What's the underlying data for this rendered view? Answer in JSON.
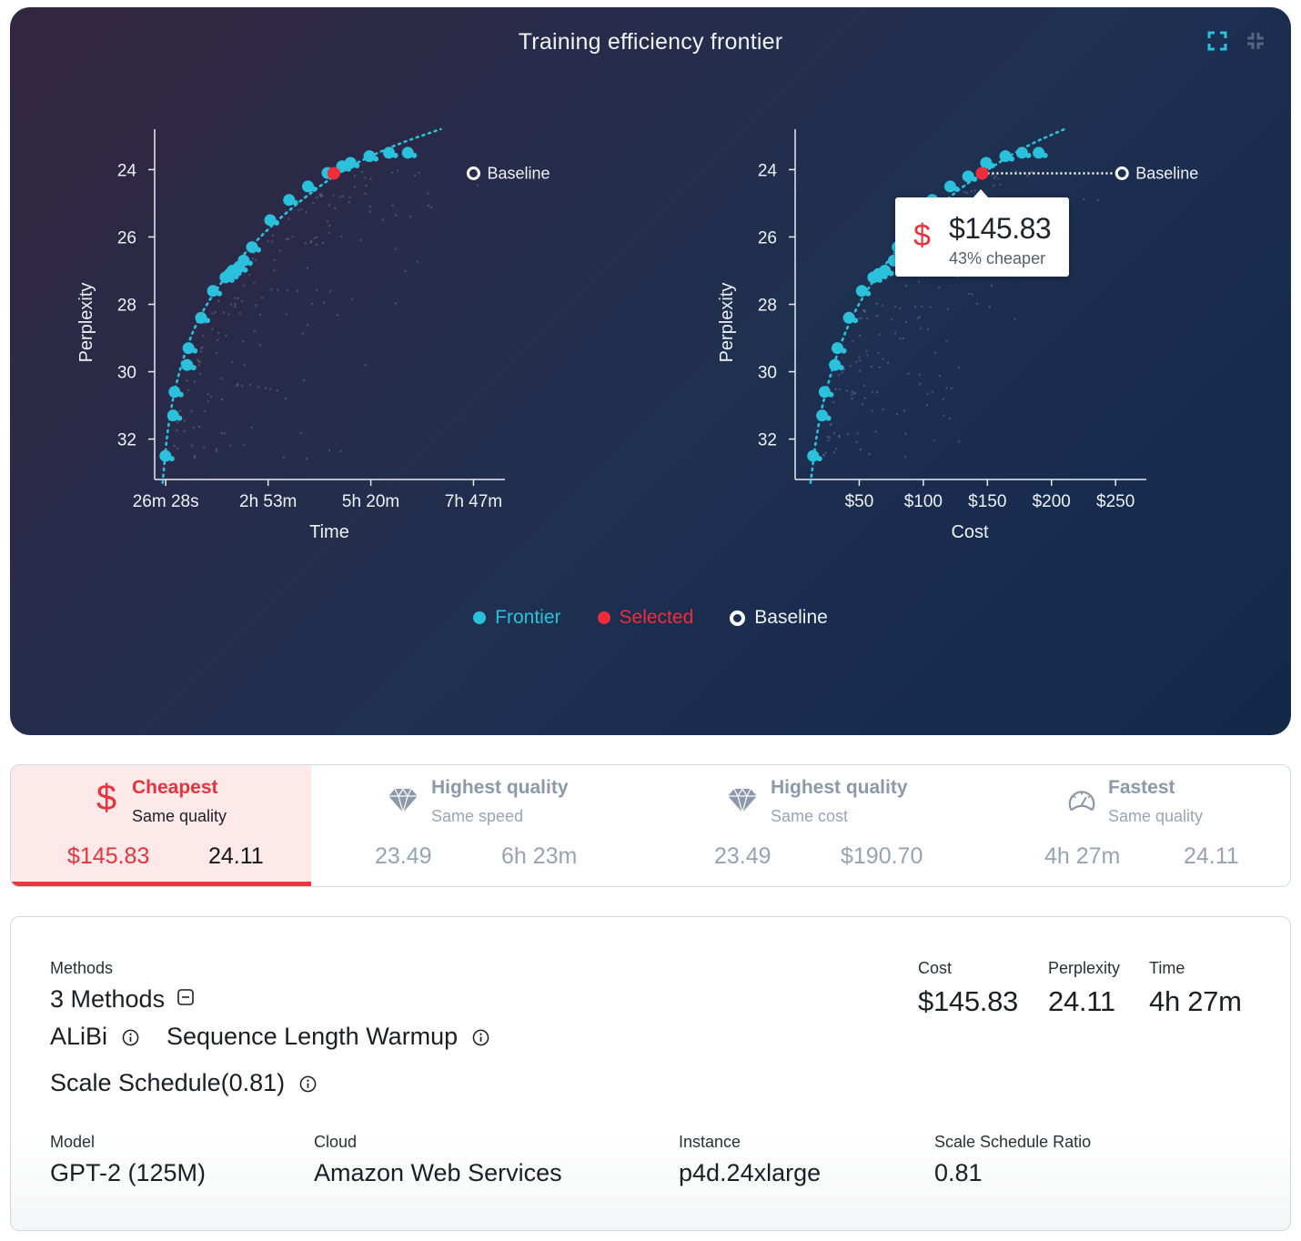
{
  "header": {
    "title": "Training efficiency frontier",
    "expand_icon": "expand-icon",
    "collapse_icon": "collapse-icon"
  },
  "colors": {
    "frontier": "#2bc1dc",
    "selected": "#ee2c3a",
    "baseline": "#ffffff",
    "accent_red": "#e8333d",
    "muted": "#8d99aa"
  },
  "tooltip": {
    "icon": "dollar-icon",
    "value": "$145.83",
    "subtitle": "43% cheaper"
  },
  "legend": [
    {
      "label": "Frontier",
      "kind": "frontier"
    },
    {
      "label": "Selected",
      "kind": "selected"
    },
    {
      "label": "Baseline",
      "kind": "baseline"
    }
  ],
  "chart_data": [
    {
      "type": "scatter",
      "title": "",
      "xlabel": "Time",
      "ylabel": "Perplexity",
      "x_unit": "minutes",
      "xlim": [
        10.6,
        512
      ],
      "ylim": [
        33.2,
        22.8
      ],
      "y_inverted": true,
      "x_ticks": [
        {
          "value": 26.47,
          "label": "26m 28s"
        },
        {
          "value": 173,
          "label": "2h 53m"
        },
        {
          "value": 320,
          "label": "5h 20m"
        },
        {
          "value": 467,
          "label": "7h 47m"
        }
      ],
      "y_ticks": [
        24,
        26,
        28,
        30,
        32
      ],
      "grid": false,
      "frontier": [
        {
          "x": 26,
          "y": 32.5
        },
        {
          "x": 37,
          "y": 31.3
        },
        {
          "x": 39,
          "y": 30.6
        },
        {
          "x": 57,
          "y": 29.8
        },
        {
          "x": 59,
          "y": 29.3
        },
        {
          "x": 77,
          "y": 28.4
        },
        {
          "x": 94,
          "y": 27.6
        },
        {
          "x": 112,
          "y": 27.2
        },
        {
          "x": 118,
          "y": 27.1
        },
        {
          "x": 122,
          "y": 27.0
        },
        {
          "x": 131,
          "y": 26.9
        },
        {
          "x": 138,
          "y": 26.7
        },
        {
          "x": 150,
          "y": 26.3
        },
        {
          "x": 176,
          "y": 25.5
        },
        {
          "x": 203,
          "y": 24.9
        },
        {
          "x": 230,
          "y": 24.5
        },
        {
          "x": 258,
          "y": 24.1
        },
        {
          "x": 279,
          "y": 23.9
        },
        {
          "x": 291,
          "y": 23.8
        },
        {
          "x": 318,
          "y": 23.6
        },
        {
          "x": 346,
          "y": 23.5
        },
        {
          "x": 373,
          "y": 23.5
        }
      ],
      "frontier_trend": [
        {
          "x": 22,
          "y": 33.3
        },
        {
          "x": 30,
          "y": 31.5
        },
        {
          "x": 45,
          "y": 30.0
        },
        {
          "x": 70,
          "y": 28.5
        },
        {
          "x": 110,
          "y": 27.2
        },
        {
          "x": 160,
          "y": 26.0
        },
        {
          "x": 220,
          "y": 24.9
        },
        {
          "x": 280,
          "y": 24.0
        },
        {
          "x": 350,
          "y": 23.3
        },
        {
          "x": 420,
          "y": 22.8
        }
      ],
      "selected": {
        "x": 267,
        "y": 24.11,
        "label": "4h 27m"
      },
      "baseline": {
        "x": 467,
        "y": 24.11,
        "label": "Baseline"
      },
      "background_points_note": "faint gray scatter of non-frontier runs"
    },
    {
      "type": "scatter",
      "title": "",
      "xlabel": "Cost",
      "ylabel": "Perplexity",
      "x_unit": "USD",
      "xlim": [
        0,
        274
      ],
      "ylim": [
        33.2,
        22.8
      ],
      "y_inverted": true,
      "x_ticks": [
        {
          "value": 50,
          "label": "$50"
        },
        {
          "value": 100,
          "label": "$100"
        },
        {
          "value": 150,
          "label": "$150"
        },
        {
          "value": 200,
          "label": "$200"
        },
        {
          "value": 250,
          "label": "$250"
        }
      ],
      "y_ticks": [
        24,
        26,
        28,
        30,
        32
      ],
      "grid": false,
      "frontier": [
        {
          "x": 14,
          "y": 32.5
        },
        {
          "x": 21,
          "y": 31.3
        },
        {
          "x": 23,
          "y": 30.6
        },
        {
          "x": 31,
          "y": 29.8
        },
        {
          "x": 33,
          "y": 29.3
        },
        {
          "x": 42,
          "y": 28.4
        },
        {
          "x": 52,
          "y": 27.6
        },
        {
          "x": 61,
          "y": 27.2
        },
        {
          "x": 65,
          "y": 27.1
        },
        {
          "x": 70,
          "y": 27.0
        },
        {
          "x": 77,
          "y": 26.7
        },
        {
          "x": 80,
          "y": 26.3
        },
        {
          "x": 92,
          "y": 25.6
        },
        {
          "x": 107,
          "y": 24.9
        },
        {
          "x": 121,
          "y": 24.5
        },
        {
          "x": 135,
          "y": 24.2
        },
        {
          "x": 149,
          "y": 23.8
        },
        {
          "x": 164,
          "y": 23.6
        },
        {
          "x": 177,
          "y": 23.5
        },
        {
          "x": 190,
          "y": 23.5
        }
      ],
      "frontier_trend": [
        {
          "x": 12,
          "y": 33.3
        },
        {
          "x": 18,
          "y": 31.5
        },
        {
          "x": 28,
          "y": 30.0
        },
        {
          "x": 42,
          "y": 28.5
        },
        {
          "x": 62,
          "y": 27.2
        },
        {
          "x": 90,
          "y": 25.9
        },
        {
          "x": 120,
          "y": 24.8
        },
        {
          "x": 150,
          "y": 24.0
        },
        {
          "x": 180,
          "y": 23.3
        },
        {
          "x": 210,
          "y": 22.8
        }
      ],
      "selected": {
        "x": 145.83,
        "y": 24.11,
        "label": "$145.83"
      },
      "baseline": {
        "x": 255,
        "y": 24.11,
        "label": "Baseline"
      },
      "background_points_note": "faint gray scatter of non-frontier runs"
    }
  ],
  "tabs": [
    {
      "title": "Cheapest",
      "subtitle": "Same quality",
      "icon": "dollar-icon",
      "value1": "$145.83",
      "value2": "24.11",
      "active": true
    },
    {
      "title": "Highest quality",
      "subtitle": "Same speed",
      "icon": "diamond-icon",
      "value1": "23.49",
      "value2": "6h 23m",
      "active": false
    },
    {
      "title": "Highest quality",
      "subtitle": "Same cost",
      "icon": "diamond-icon",
      "value1": "23.49",
      "value2": "$190.70",
      "active": false
    },
    {
      "title": "Fastest",
      "subtitle": "Same quality",
      "icon": "speedometer-icon",
      "value1": "4h 27m",
      "value2": "24.11",
      "active": false
    }
  ],
  "details": {
    "methods_label": "Methods",
    "methods_count": "3 Methods",
    "methods": [
      "ALiBi",
      "Sequence Length Warmup",
      "Scale Schedule(0.81)"
    ],
    "metrics": [
      {
        "label": "Cost",
        "value": "$145.83"
      },
      {
        "label": "Perplexity",
        "value": "24.11"
      },
      {
        "label": "Time",
        "value": "4h 27m"
      }
    ],
    "fields": [
      {
        "label": "Model",
        "value": "GPT-2 (125M)"
      },
      {
        "label": "Cloud",
        "value": "Amazon Web Services"
      },
      {
        "label": "Instance",
        "value": "p4d.24xlarge"
      },
      {
        "label": "Scale Schedule Ratio",
        "value": "0.81"
      }
    ]
  }
}
